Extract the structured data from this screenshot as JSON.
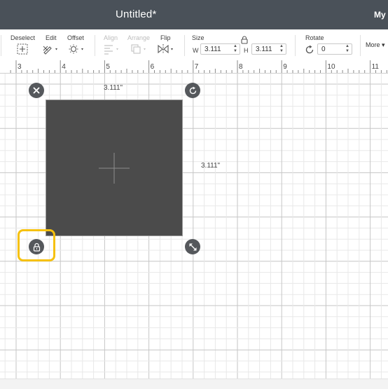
{
  "header": {
    "title": "Untitled*",
    "project_link": "My P"
  },
  "toolbar": {
    "deselect": "Deselect",
    "edit": "Edit",
    "offset": "Offset",
    "align": "Align",
    "arrange": "Arrange",
    "flip": "Flip",
    "size": "Size",
    "width_label": "W",
    "width_value": "3.111",
    "height_label": "H",
    "height_value": "3.111",
    "rotate": "Rotate",
    "rotate_value": "0",
    "more": "More"
  },
  "ruler": {
    "labels": [
      "3",
      "4",
      "5",
      "6",
      "7",
      "8",
      "9",
      "10",
      "11"
    ]
  },
  "canvas": {
    "width_dim": "3.111\"",
    "height_dim": "3.111\"",
    "shape_color": "#4b4b4b",
    "highlight_color": "#f6c10e"
  },
  "icons": {
    "close": "close-icon",
    "rotate": "rotate-icon",
    "lock": "lock-icon",
    "resize": "resize-icon"
  }
}
